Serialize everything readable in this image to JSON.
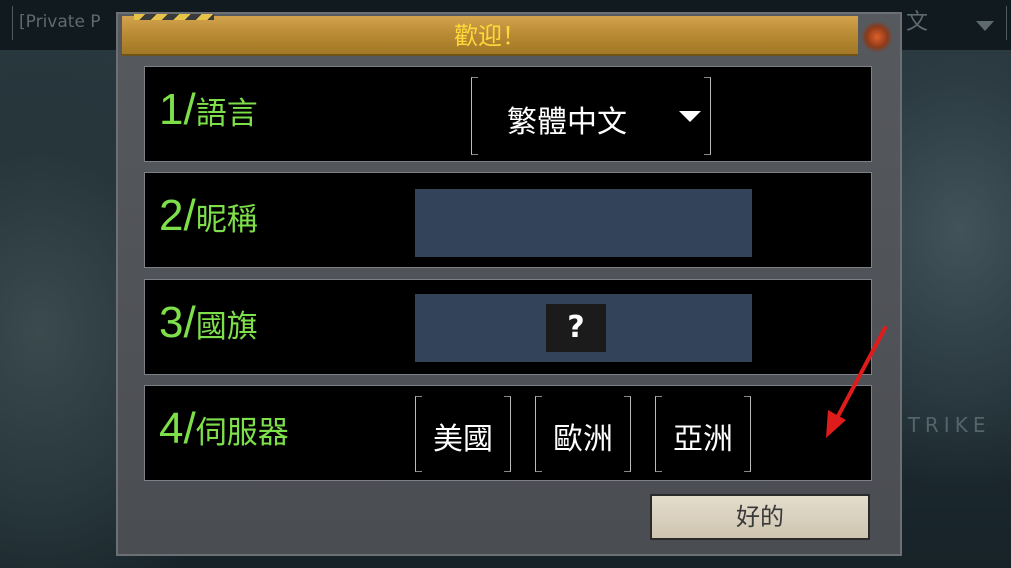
{
  "background": {
    "top_left_text": "[Private P",
    "top_right_language": "文",
    "watermark_text": "STRIKE"
  },
  "dialog": {
    "title": "歡迎！",
    "rows": [
      {
        "num": "1",
        "label": "語言"
      },
      {
        "num": "2",
        "label": "昵稱"
      },
      {
        "num": "3",
        "label": "國旗"
      },
      {
        "num": "4",
        "label": "伺服器"
      }
    ],
    "language_selected": "繁體中文",
    "nickname_value": "",
    "flag_button": "?",
    "servers": [
      "美國",
      "歐洲",
      "亞洲"
    ],
    "ok_button": "好的"
  },
  "colors": {
    "label_green": "#7de04a",
    "title_yellow": "#ffd93a",
    "field_blue": "#334359",
    "arrow_red": "#e01b1b"
  }
}
